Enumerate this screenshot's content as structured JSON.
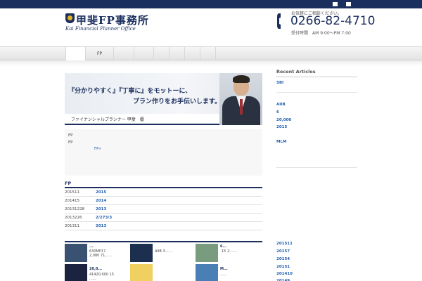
{
  "header": {
    "logo_title": "甲斐FP事務所",
    "logo_subtitle": "Kai Financial Planner Office",
    "contact_prompt": "お気軽にご相談ください。",
    "phone": "0266-82-4710",
    "hours": "受付時間　AM 9:00～PM 7:00"
  },
  "nav": {
    "items": [
      {
        "label": ""
      },
      {
        "label": "FP"
      },
      {
        "label": ""
      },
      {
        "label": ""
      },
      {
        "label": ""
      },
      {
        "label": ""
      },
      {
        "label": ""
      },
      {
        "label": ""
      }
    ]
  },
  "banner": {
    "line1": "『分かりやすく』『丁寧に』をモットーに、",
    "line2": "プラン作りをお手伝いします。",
    "caption": "ファイナンシャルプランナー 甲斐　優"
  },
  "intro": {
    "line1": "FP",
    "line2": "FP",
    "link": "FP»"
  },
  "news": {
    "title": "FP",
    "rows": [
      {
        "date": "201511",
        "title": "2015"
      },
      {
        "date": "201415",
        "title": "2014"
      },
      {
        "date": "20131228",
        "title": "2013"
      },
      {
        "date": "2013226",
        "title": "2/273/3"
      },
      {
        "date": "201311",
        "title": "2013"
      }
    ]
  },
  "thumbs": [
    {
      "title": "...",
      "text": "630MP17\n2,080 71......",
      "icon": "building-photo",
      "color": "#3a5272"
    },
    {
      "title": "",
      "text": "AIIB 3.......",
      "icon": "aiib-logo",
      "color": "#1d2f4f"
    },
    {
      "title": "6...",
      "text": "15 2.......",
      "icon": "dollar-bills-photo",
      "color": "#7a9c7e"
    },
    {
      "title": "20,0...",
      "text": "41420,000 15\n......",
      "icon": "night-city-photo",
      "color": "#1a2340"
    },
    {
      "title": "",
      "text": "",
      "icon": "currency-icons",
      "color": "#f0d060"
    },
    {
      "title": "M...",
      "text": "......",
      "icon": "globe-photo",
      "color": "#4a7fb5"
    }
  ],
  "sidebar": {
    "title": "Recent Articles",
    "articles": [
      "SBI",
      "AIIB",
      "6",
      "20,000",
      "2015",
      "MLM"
    ],
    "archives": [
      "201511",
      "20157",
      "20154",
      "20151",
      "201410",
      "20149"
    ]
  }
}
